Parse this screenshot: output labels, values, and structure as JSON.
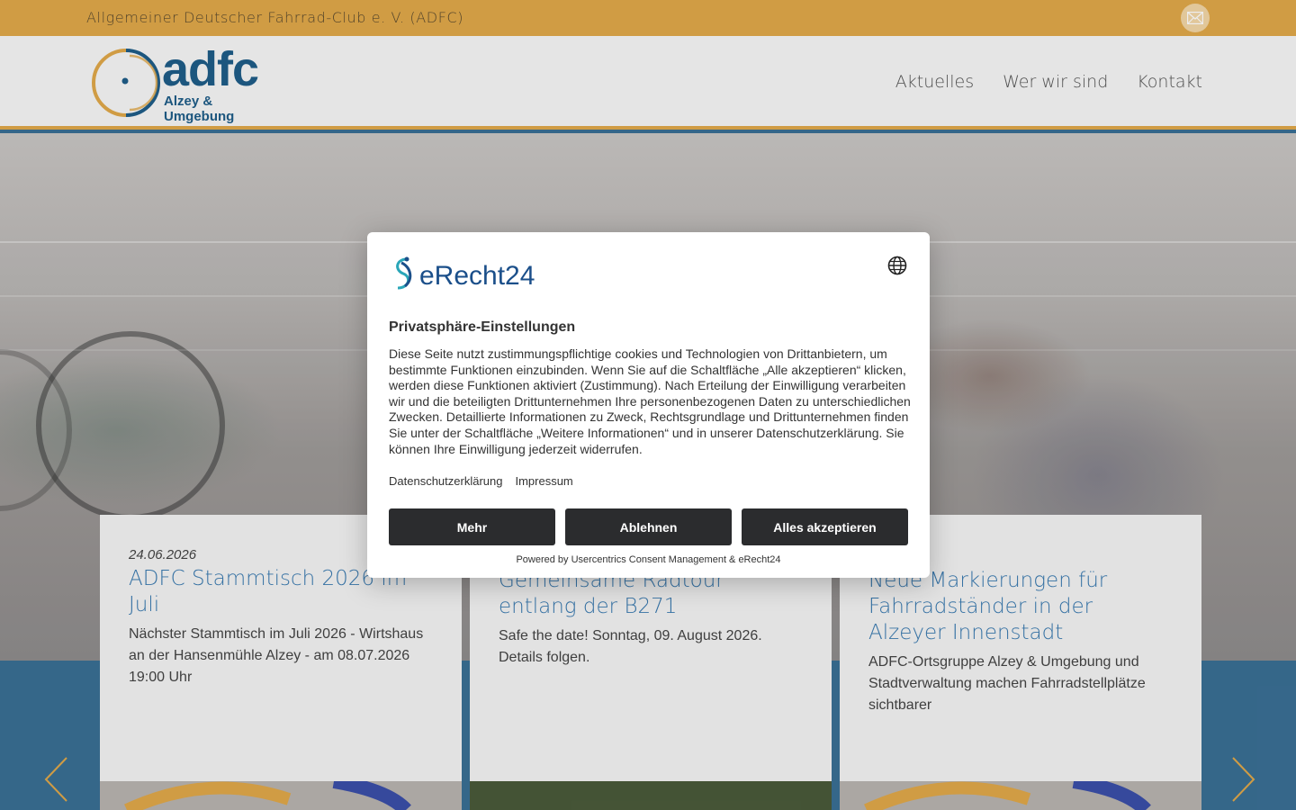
{
  "topbar": {
    "org_name": "Allgemeiner Deutscher Fahrrad-Club e. V. (ADFC)",
    "mail_icon": "mail-icon"
  },
  "header": {
    "logo_word": "adfc",
    "logo_sub": "Alzey & Umgebung",
    "nav": [
      "Aktuelles",
      "Wer wir sind",
      "Kontakt"
    ]
  },
  "cards": [
    {
      "date": "24.06.2026",
      "title": "ADFC Stammtisch 2026 im Juli",
      "text": "Nächster Stammtisch im Juli 2026 - Wirtshaus an der Hansenmühle Alzey - am 08.07.2026 19:00 Uhr"
    },
    {
      "date": "",
      "title": "Gemeinsame Radtour entlang der B271",
      "text": "Safe the date! Sonntag, 09. August 2026. Details folgen."
    },
    {
      "date": "",
      "title": "Neue Markierungen für Fahrradständer in der Alzeyer Innenstadt",
      "text": "ADFC-Ortsgruppe Alzey & Umgebung und Stadtverwaltung machen Fahrradstellplätze sichtbarer"
    }
  ],
  "consent": {
    "brand": "eRecht24",
    "title": "Privatsphäre-Einstellungen",
    "body": "Diese Seite nutzt zustimmungspflichtige cookies und Technologien von Drittanbietern, um bestimmte Funktionen einzubinden. Wenn Sie auf die Schaltfläche „Alle akzeptieren“ klicken, werden diese Funktionen aktiviert (Zustimmung). Nach Erteilung der Einwilligung verarbeiten wir und die beteiligten Drittunternehmen Ihre personenbezogenen Daten zu unterschiedlichen Zwecken. Detaillierte Informationen zu Zweck, Rechtsgrundlage und Drittunternehmen finden Sie unter der Schaltfläche „Weitere Informationen“ und in unserer Datenschutzerklärung. Sie können Ihre Einwilligung jederzeit widerrufen.",
    "links": [
      "Datenschutzerklärung",
      "Impressum"
    ],
    "buttons": {
      "more": "Mehr",
      "decline": "Ablehnen",
      "accept": "Alles akzeptieren"
    },
    "powered_by": "Powered by Usercentrics Consent Management & eRecht24"
  },
  "colors": {
    "accent": "#e0a84a",
    "brand_blue": "#1f5d88",
    "link_blue": "#3a7ab0",
    "button_dark": "#2b2c2e"
  }
}
